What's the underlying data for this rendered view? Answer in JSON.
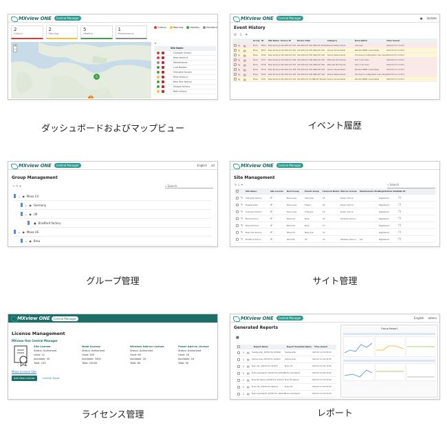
{
  "brand": {
    "name": "MXview ONE",
    "pill": "Central Manager"
  },
  "captions": [
    "ダッシュボードおよびマップビュー",
    "イベント履歴",
    "グループ管理",
    "サイト管理",
    "ライセンス管理",
    "レポート"
  ],
  "dashboard": {
    "stats": [
      {
        "value": "2",
        "label": "Critical",
        "color": "#e53935"
      },
      {
        "value": "2",
        "label": "Warning",
        "color": "#fbc02d"
      },
      {
        "value": "5",
        "label": "Healthy",
        "color": "#43a047"
      },
      {
        "value": "1",
        "label": "Maintenance",
        "color": "#8e8e8e"
      }
    ],
    "legend": [
      "Critical",
      "Warning",
      "Healthy",
      "Maintenance"
    ],
    "list_header": "Site Name",
    "sites": [
      "Chengdu factory",
      "Brea factory1",
      "Maintenance",
      "Lure Nestort",
      "Shanghai factory",
      "Brea factory2",
      "New York factory",
      "Shaped factory",
      "Bath factory"
    ],
    "site_status": [
      "#e53935",
      "#e53935",
      "#8e8e8e",
      "#43a047",
      "#43a047",
      "#fbc02d",
      "#43a047",
      "#43a047",
      "#fbc02d"
    ]
  },
  "events": {
    "title": "Event History",
    "top_right": "Update",
    "columns": [
      "Group",
      "ID",
      "Site Name",
      "Source IP",
      "Device Alias",
      "Category",
      "Description",
      "Time Issued"
    ],
    "rows": [
      {
        "group": "Moxa",
        "id": "8814",
        "site": "Brea factory1",
        "ip": "192.168.127.222",
        "alias": "192.168.127.222 (NB).M1 Moxa/w",
        "cat": "Device Status Alerts",
        "desc": "Unknown",
        "time": "2022-03-27 11:02:0",
        "c": "#fde8e8"
      },
      {
        "group": "Moxa",
        "id": "8815",
        "site": "Brea factory1",
        "ip": "192.168.127.225",
        "alias": "192.168.127.225 (NB).A8 7101",
        "cat": "Device Unreachable",
        "desc": "Remote SNMP unreachable",
        "time": "2022-03-27 11:00:0",
        "c": "#fff6d6"
      },
      {
        "group": "Moxa",
        "id": "8116",
        "site": "Brea factory1",
        "ip": "192.168.127.221",
        "alias": "192.168.127.225 (NB).A8 7101",
        "cat": "Device Status Alerts",
        "desc": "The device configuration has changed",
        "time": "2022-03-27 11:00:3",
        "c": "#fff6d6"
      },
      {
        "group": "Moxa",
        "id": "8717",
        "site": "Brea factory1",
        "ip": "192.168.127.206",
        "alias": "192.168.127.206 (NB).A8 7101",
        "cat": "Ethernet Port Events",
        "desc": "PoE 7 link down",
        "time": "2022-03-27 11:00:3",
        "c": "#fde8e8"
      },
      {
        "group": "Moxa",
        "id": "8718",
        "site": "Brea factory1",
        "ip": "192.168.127.225",
        "alias": "192.168.127.224 (NB).A8 7101",
        "cat": "Ethernet Port Events",
        "desc": "Port 7 link down",
        "time": "2022-03-27 11:00:3",
        "c": "#fde8e8"
      },
      {
        "group": "Moxa",
        "id": "8719",
        "site": "Brea factory1",
        "ip": "192.168.127.228",
        "alias": "192.168.127.224 (NB).A8 7101",
        "cat": "Device Unreachable",
        "desc": "Remote SNMP unreachable",
        "time": "2022-03-27 11:00:3",
        "c": "#fde8e8"
      },
      {
        "group": "Moxa",
        "id": "8720",
        "site": "Brea factory1",
        "ip": "192.168.127.226",
        "alias": "192.168.127.226 (NB).A8 7101",
        "cat": "Device Status Alerts",
        "desc": "The device configuration has changed",
        "time": "2022-03-27 11:00:3",
        "c": "#fde8e8"
      },
      {
        "group": "Moxa",
        "id": "8721",
        "site": "Brea factory1",
        "ip": "192.168.127.222",
        "alias": "192.168.127.22 (NB).M1 Moxa/w",
        "cat": "Device Unreachable",
        "desc": "Remote SNMP unreachable",
        "time": "2022-03-27 11:00:3",
        "c": "#fff6d6"
      }
    ]
  },
  "groups": {
    "title": "Group Management",
    "top_right": [
      "English",
      "ad"
    ],
    "search": "Search",
    "items": [
      {
        "label": "Moxa CU",
        "depth": 0
      },
      {
        "label": "Germany",
        "depth": 1
      },
      {
        "label": "UK",
        "depth": 1
      },
      {
        "label": "Bradford factory",
        "depth": 2
      },
      {
        "label": "Moxa US",
        "depth": 0
      },
      {
        "label": "Brea",
        "depth": 1
      }
    ]
  },
  "sites": {
    "title": "Site Management",
    "search": "Search",
    "columns": [
      "Site Name",
      "Site License",
      "Root Group",
      "Parent Group",
      "Licensed Nodes",
      "Add-on License",
      "Maintenance Mode",
      "Registration Status",
      "Site ID"
    ],
    "rows": [
      {
        "name": "Shanghai factory",
        "root": "Moxa Asia",
        "parent": "Shanghai",
        "nodes": "15",
        "addon": "Power Add-on",
        "mm": "",
        "reg": "Registered"
      },
      {
        "name": "Headquarter",
        "root": "Moxa Asia",
        "parent": "Taiwan",
        "nodes": "84",
        "addon": "Power Add-on",
        "mm": "",
        "reg": "Registered"
      },
      {
        "name": "Chengdu factory",
        "root": "Moxa Asia",
        "parent": "Chengdu",
        "nodes": "15",
        "addon": "Power Add-on",
        "mm": "",
        "reg": "Registered"
      },
      {
        "name": "Brea factory1",
        "root": "Moxa US",
        "parent": "Brea",
        "nodes": "22",
        "addon": "Wireless Add-on",
        "mm": "",
        "reg": "Registered"
      },
      {
        "name": "Brea factory2",
        "root": "Moxa US",
        "parent": "Brea",
        "nodes": "13",
        "addon": "",
        "mm": "",
        "reg": "Registered"
      },
      {
        "name": "New York factory",
        "root": "Moxa US",
        "parent": "New York",
        "nodes": "15",
        "addon": "",
        "mm": "",
        "reg": "Registered"
      },
      {
        "name": "Bradford factory",
        "root": "Moxa EU",
        "parent": "UK",
        "nodes": "23",
        "addon": "Wireless Add-on",
        "mm": "Yes",
        "reg": "Registered"
      }
    ]
  },
  "license": {
    "title": "License Management",
    "section": "MXview One Central Manager",
    "blocks": [
      {
        "title": "Site License",
        "status": "Status: Authorized",
        "used": "Used: 12",
        "avail": "Available: 30",
        "total": "Total: 100"
      },
      {
        "title": "Node License",
        "status": "Status: Authorized",
        "used": "Used: 500",
        "avail": "Available: 3400",
        "total": "Total: 10000"
      },
      {
        "title": "Wireless Add-on License",
        "status": "Status: Authorized",
        "used": "Used: 60",
        "avail": "Available: 20",
        "total": "Total: 80"
      },
      {
        "title": "Power Add-on License",
        "status": "Status: Authorized",
        "used": "Used: 18",
        "avail": "Available: 16",
        "total": "Total: 30"
      }
    ],
    "link": "Moxa License Site",
    "add_button": "Add New License",
    "types_link": "License Types"
  },
  "reports": {
    "title": "Generated Reports",
    "top_right": [
      "English",
      "admin"
    ],
    "columns": [
      "Report Name",
      "Report Template Name",
      "Time Issued"
    ],
    "rows": [
      {
        "name": "Headquarter_20230714_033400",
        "tmpl": "Headquarter",
        "time": "2023-07-14 03:34:00"
      },
      {
        "name": "Gemsa-view_20230714_023404",
        "tmpl": "Gemsa-view",
        "time": "2023-07-14 02:34:00"
      },
      {
        "name": "Moxa US-_20230714_031024",
        "tmpl": "Moxa US",
        "time": "2023-07-14 03:10:00"
      },
      {
        "name": "Moxa Asia Report_20230714_001646",
        "tmpl": "Moxa Asia Report",
        "time": "2023-07-14 00:16:00"
      },
      {
        "name": "Moxa EU Report_20230714_221414",
        "tmpl": "Moxa EU Report",
        "time": "2023-07-13 22:14:00"
      },
      {
        "name": "Moxa US-_20230713_205419",
        "tmpl": "Moxa US",
        "time": "2023-07-13 20:54:00"
      },
      {
        "name": "Moxa Asia Report_20230713_181212",
        "tmpl": "Moxa Asia Report",
        "time": "2023-07-13 18:12:00"
      }
    ],
    "preview_title": "Group Report"
  }
}
